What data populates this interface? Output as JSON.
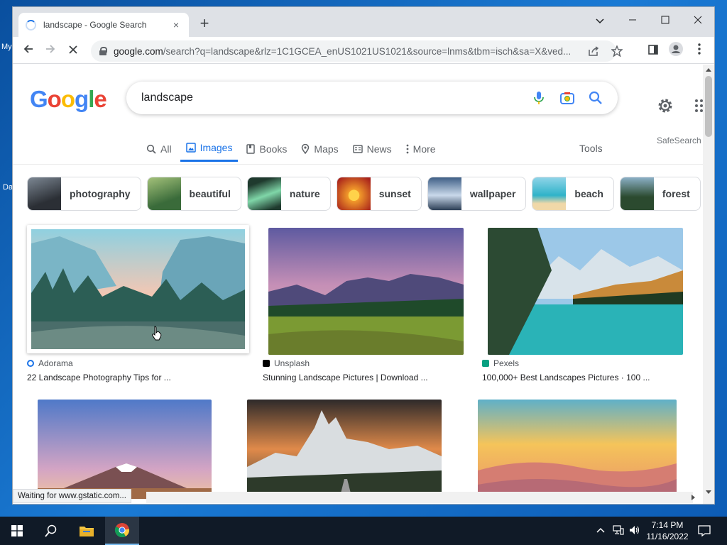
{
  "desktop": {
    "icon_label_1": "My",
    "icon_label_2": "Da"
  },
  "browser": {
    "tab_title": "landscape - Google Search",
    "tab_close": "×",
    "new_tab": "+",
    "url_host": "google.com",
    "url_path": "/search?q=landscape&rlz=1C1GCEA_enUS1021US1021&source=lnms&tbm=isch&sa=X&ved...",
    "window_controls": {
      "chevron": "⌄",
      "minimize": "–",
      "maximize": "☐",
      "close": "✕"
    },
    "status_text": "Waiting for www.gstatic.com..."
  },
  "google": {
    "logo_letters": [
      "G",
      "o",
      "o",
      "g",
      "l",
      "e"
    ],
    "search_query": "landscape",
    "safesearch": "SafeSearch",
    "tools": "Tools",
    "nav_tabs": [
      {
        "label": "All",
        "icon": "search-icon",
        "active": false
      },
      {
        "label": "Images",
        "icon": "image-icon",
        "active": true
      },
      {
        "label": "Books",
        "icon": "book-icon",
        "active": false
      },
      {
        "label": "Maps",
        "icon": "map-pin-icon",
        "active": false
      },
      {
        "label": "News",
        "icon": "news-icon",
        "active": false
      },
      {
        "label": "More",
        "icon": "more-vert-icon",
        "active": false
      }
    ],
    "chips": [
      {
        "label": "photography",
        "colors": [
          "#2b2f35",
          "#7d8894"
        ]
      },
      {
        "label": "beautiful",
        "colors": [
          "#3a6b3a",
          "#a4c27a"
        ]
      },
      {
        "label": "nature",
        "colors": [
          "#1f3a2e",
          "#7fd6a8"
        ]
      },
      {
        "label": "sunset",
        "colors": [
          "#f29a2a",
          "#a8221b"
        ]
      },
      {
        "label": "wallpaper",
        "colors": [
          "#3f5f86",
          "#c9d8ea"
        ]
      },
      {
        "label": "beach",
        "colors": [
          "#2fb3c9",
          "#f0d8a8"
        ]
      },
      {
        "label": "forest",
        "colors": [
          "#2b4a2f",
          "#8bb0c6"
        ]
      }
    ],
    "results": [
      {
        "source": "Adorama",
        "title": "22 Landscape Photography Tips for ...",
        "source_color": "#1a73e8",
        "sky": "#9fd2dc",
        "ground": "#3d5b5a"
      },
      {
        "source": "Unsplash",
        "title": "Stunning Landscape Pictures | Download ...",
        "source_color": "#000000",
        "sky": "#6f64a6",
        "ground": "#6f8f2f"
      },
      {
        "source": "Pexels",
        "title": "100,000+ Best Landscapes Pictures · 100 ...",
        "source_color": "#07a081",
        "sky": "#8fc1e6",
        "ground": "#2ab3b7"
      },
      {
        "sky": "#6c7fc0",
        "ground": "#a06a47"
      },
      {
        "sky": "#e08a4a",
        "ground": "#3a3f3a"
      },
      {
        "sky": "#f0b858",
        "ground": "#d57d72"
      }
    ]
  },
  "taskbar": {
    "time": "7:14 PM",
    "date": "11/16/2022"
  }
}
